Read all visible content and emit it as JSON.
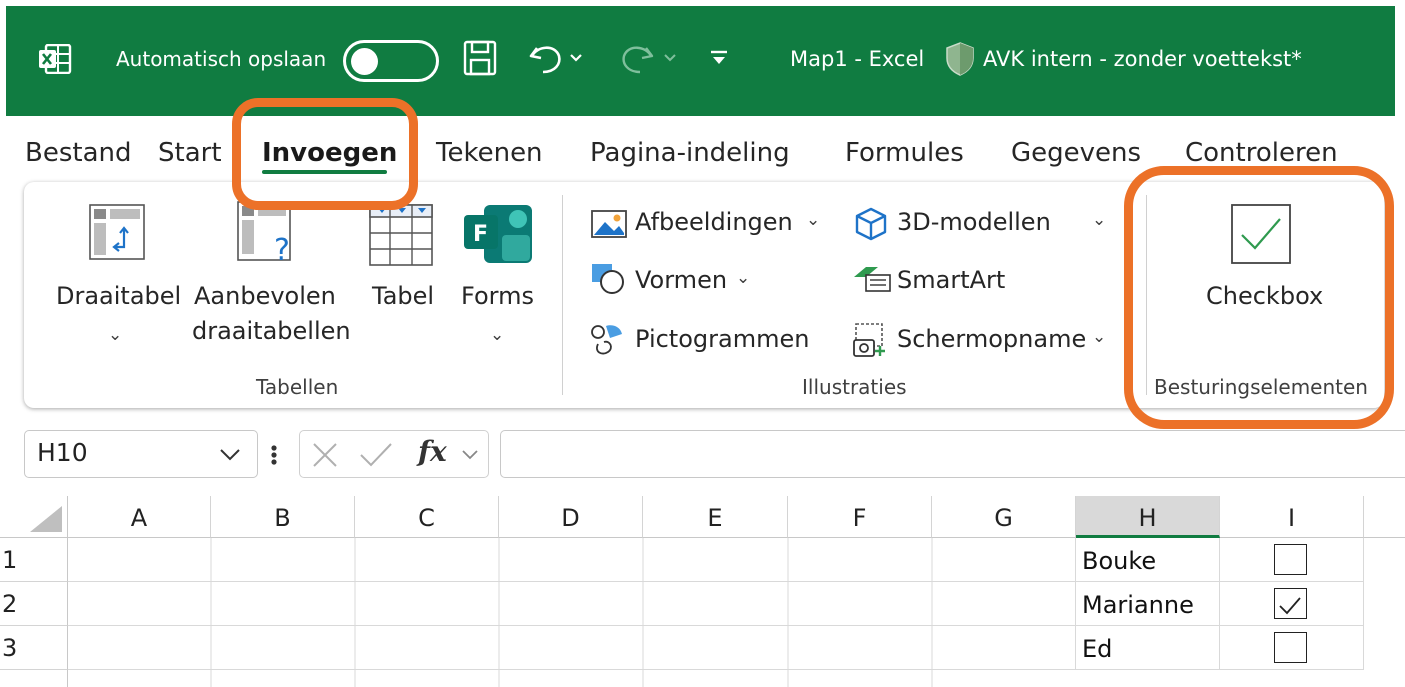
{
  "titlebar": {
    "autosave_label": "Automatisch opslaan",
    "doc_title": "Map1  -  Excel",
    "sensitivity_label": "AVK intern - zonder voettekst*",
    "bar_color": "#107c41"
  },
  "tabs": [
    {
      "label": "Bestand"
    },
    {
      "label": "Start"
    },
    {
      "label": "Invoegen",
      "active": true
    },
    {
      "label": "Tekenen"
    },
    {
      "label": "Pagina-indeling"
    },
    {
      "label": "Formules"
    },
    {
      "label": "Gegevens"
    },
    {
      "label": "Controleren"
    }
  ],
  "ribbon": {
    "tabellen": {
      "draaitabel": "Draaitabel",
      "aanbevolen_1": "Aanbevolen",
      "aanbevolen_2": "draaitabellen",
      "tabel": "Tabel",
      "forms": "Forms",
      "group_label": "Tabellen"
    },
    "illustraties": {
      "afbeeldingen": "Afbeeldingen",
      "vormen": "Vormen",
      "pictogrammen": "Pictogrammen",
      "modellen_3d": "3D-modellen",
      "smartart": "SmartArt",
      "schermopname": "Schermopname",
      "group_label": "Illustraties"
    },
    "besturingselementen": {
      "checkbox": "Checkbox",
      "group_label": "Besturingselementen"
    }
  },
  "formula_bar": {
    "name_box": "H10",
    "fx_label": "fx",
    "formula": ""
  },
  "grid": {
    "columns": [
      "A",
      "B",
      "C",
      "D",
      "E",
      "F",
      "G",
      "H",
      "I"
    ],
    "selected_column": "H",
    "rows": [
      {
        "num": "1",
        "H": "Bouke",
        "I_checked": false
      },
      {
        "num": "2",
        "H": "Marianne",
        "I_checked": true
      },
      {
        "num": "3",
        "H": "Ed",
        "I_checked": false
      }
    ]
  },
  "highlight_color": "#ec7128"
}
